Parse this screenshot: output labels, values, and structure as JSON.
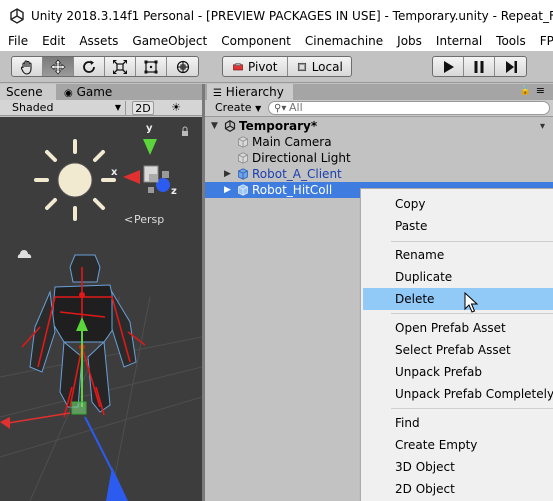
{
  "window": {
    "title": "Unity 2018.3.14f1 Personal - [PREVIEW PACKAGES IN USE] - Temporary.unity - Repeat_FPS_Sam"
  },
  "menu": [
    "File",
    "Edit",
    "Assets",
    "GameObject",
    "Component",
    "Cinemachine",
    "Jobs",
    "Internal",
    "Tools",
    "FPS Sampl"
  ],
  "toolbar": {
    "pivot_label": "Pivot",
    "local_label": "Local"
  },
  "scene_panel": {
    "tabs": [
      "Scene",
      "Game"
    ],
    "shading_mode": "Shaded",
    "mode_2d": "2D",
    "persp_label": "Persp",
    "gizmo_axes": [
      "y",
      "x",
      "z"
    ]
  },
  "hierarchy": {
    "tab_label": "Hierarchy",
    "create_label": "Create",
    "search_placeholder": "All",
    "scene_name": "Temporary*",
    "items": [
      {
        "label": "Main Camera"
      },
      {
        "label": "Directional Light"
      },
      {
        "label": "Robot_A_Client"
      },
      {
        "label": "Robot_HitColl"
      }
    ]
  },
  "context_menu": {
    "items": [
      "Copy",
      "Paste",
      "Rename",
      "Duplicate",
      "Delete",
      "Open Prefab Asset",
      "Select Prefab Asset",
      "Unpack Prefab",
      "Unpack Prefab Completely",
      "Find",
      "Create Empty",
      "3D Object",
      "2D Object"
    ],
    "highlighted": "Delete"
  },
  "colors": {
    "selection": "#3e7ce0",
    "menu_highlight": "#91c9f7",
    "prefab_text": "#1a3fb0"
  }
}
